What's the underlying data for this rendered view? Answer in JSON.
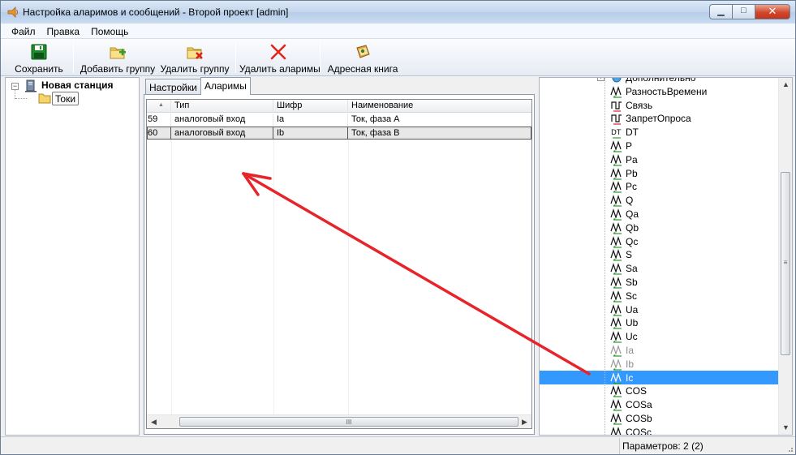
{
  "window": {
    "title": "Настройка аларимов и сообщений - Второй проект [admin]"
  },
  "menu": [
    "Файл",
    "Правка",
    "Помощь"
  ],
  "toolbar": {
    "save": "Сохранить",
    "add_group": "Добавить группу",
    "delete_group": "Удалить группу",
    "delete_alarms": "Удалить аларимы",
    "address_book": "Адресная книга"
  },
  "left_tree": {
    "station": "Новая станция",
    "group": "Токи"
  },
  "tabs": [
    "Настройки",
    "Аларимы"
  ],
  "grid": {
    "columns": [
      "",
      "Тип",
      "Шифр",
      "Наименование"
    ],
    "rows": [
      {
        "id": "59",
        "type": "аналоговый вход",
        "code": "Ia",
        "name": "Ток, фаза A"
      },
      {
        "id": "60",
        "type": "аналоговый вход",
        "code": "Ib",
        "name": "Ток, фаза B"
      }
    ],
    "grip": "III"
  },
  "right_tree": {
    "items": [
      {
        "label": "Дополнительно",
        "kind": "folder",
        "state": "normal"
      },
      {
        "label": "РазностьВремени",
        "kind": "analog",
        "state": "normal"
      },
      {
        "label": "Связь",
        "kind": "discrete",
        "state": "normal"
      },
      {
        "label": "ЗапретОпроса",
        "kind": "discrete",
        "state": "normal"
      },
      {
        "label": "DT",
        "kind": "time",
        "state": "normal"
      },
      {
        "label": "P",
        "kind": "analog",
        "state": "normal"
      },
      {
        "label": "Pa",
        "kind": "analog",
        "state": "normal"
      },
      {
        "label": "Pb",
        "kind": "analog",
        "state": "normal"
      },
      {
        "label": "Pc",
        "kind": "analog",
        "state": "normal"
      },
      {
        "label": "Q",
        "kind": "analog",
        "state": "normal"
      },
      {
        "label": "Qa",
        "kind": "analog",
        "state": "normal"
      },
      {
        "label": "Qb",
        "kind": "analog",
        "state": "normal"
      },
      {
        "label": "Qc",
        "kind": "analog",
        "state": "normal"
      },
      {
        "label": "S",
        "kind": "analog",
        "state": "normal"
      },
      {
        "label": "Sa",
        "kind": "analog",
        "state": "normal"
      },
      {
        "label": "Sb",
        "kind": "analog",
        "state": "normal"
      },
      {
        "label": "Sc",
        "kind": "analog",
        "state": "normal"
      },
      {
        "label": "Ua",
        "kind": "analog",
        "state": "normal"
      },
      {
        "label": "Ub",
        "kind": "analog",
        "state": "normal"
      },
      {
        "label": "Uc",
        "kind": "analog",
        "state": "normal"
      },
      {
        "label": "Ia",
        "kind": "analog",
        "state": "dim"
      },
      {
        "label": "Ib",
        "kind": "analog",
        "state": "dim"
      },
      {
        "label": "Ic",
        "kind": "analog",
        "state": "selected"
      },
      {
        "label": "COS",
        "kind": "analog",
        "state": "normal"
      },
      {
        "label": "COSa",
        "kind": "analog",
        "state": "normal"
      },
      {
        "label": "COSb",
        "kind": "analog",
        "state": "normal"
      },
      {
        "label": "COSc",
        "kind": "analog",
        "state": "normal"
      }
    ],
    "scroll_grip": "≡"
  },
  "status": {
    "params": "Параметров: 2 (2)"
  },
  "colors": {
    "selection": "#3399ff",
    "annotation_arrow": "#e8242b"
  }
}
